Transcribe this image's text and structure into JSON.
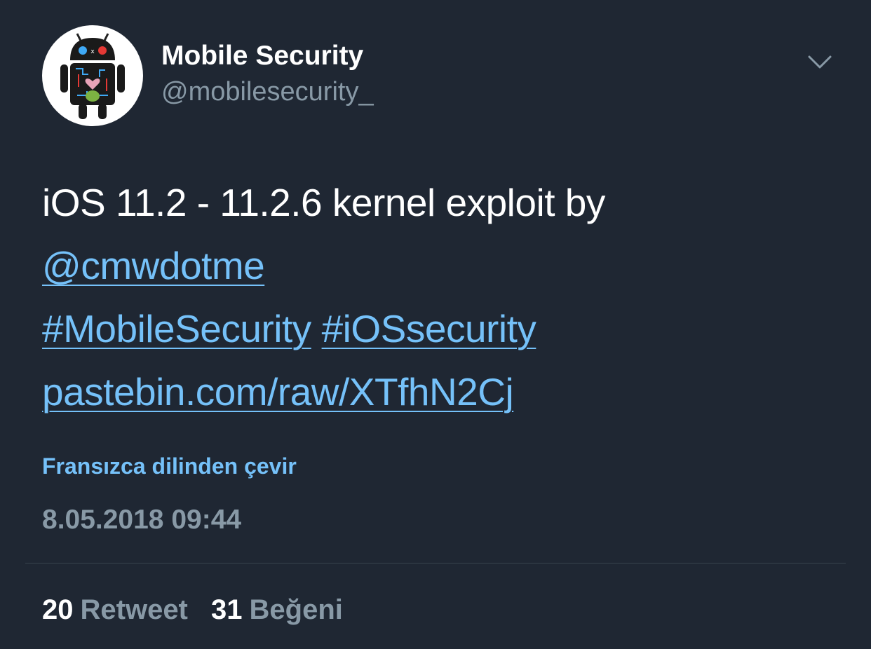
{
  "author": {
    "display_name": "Mobile Security",
    "handle": "@mobilesecurity_",
    "avatar_icon": "android-robot-icon"
  },
  "menu": {
    "icon": "chevron-down-icon"
  },
  "tweet": {
    "text_line_1": "iOS 11.2 - 11.2.6 kernel exploit by",
    "mention": "@cmwdotme",
    "hashtag_1": "#MobileSecurity",
    "hashtag_2": "#iOSsecurity",
    "url": "pastebin.com/raw/XTfhN2Cj"
  },
  "translate_label": "Fransızca dilinden çevir",
  "timestamp": "8.05.2018 09:44",
  "stats": {
    "retweet_count": "20",
    "retweet_label": "Retweet",
    "like_count": "31",
    "like_label": "Beğeni"
  },
  "colors": {
    "background": "#1f2733",
    "link": "#75c1f9",
    "secondary_text": "#8899a6",
    "divider": "#38444d"
  }
}
